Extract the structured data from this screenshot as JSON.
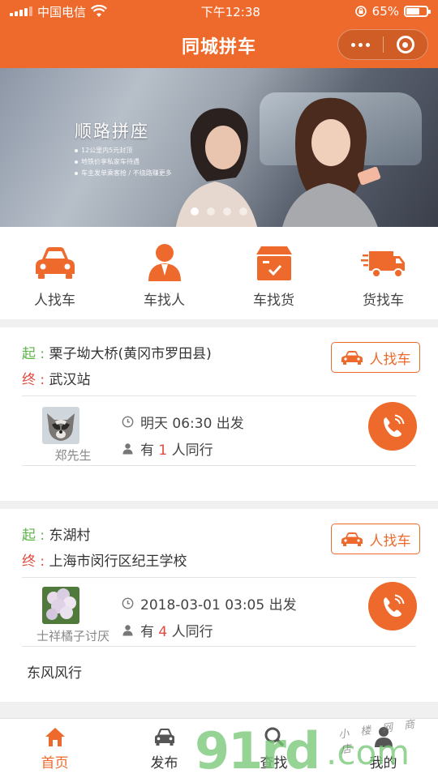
{
  "status_bar": {
    "carrier": "中国电信",
    "time": "下午12:38",
    "battery": "65%"
  },
  "header": {
    "title": "同城拼车"
  },
  "banner": {
    "title": "顺路拼座",
    "lines": [
      "12公里内5元封顶",
      "地铁价享私家车待遇",
      "车主发单乘客抢 / 不绕路赚更多"
    ],
    "slide_count": 4,
    "active_slide": 1
  },
  "categories": [
    {
      "label": "人找车",
      "icon": "car-icon"
    },
    {
      "label": "车找人",
      "icon": "person-icon"
    },
    {
      "label": "车找货",
      "icon": "cargo-box-icon"
    },
    {
      "label": "货找车",
      "icon": "truck-icon"
    }
  ],
  "trips": [
    {
      "start_label": "起",
      "start": "栗子坳大桥(黄冈市罗田县)",
      "end_label": "终",
      "end": "武汉站",
      "tag": "人找车",
      "user": "郑先生",
      "depart": "明天 06:30 出发",
      "companions_prefix": "有",
      "companions": "1",
      "companions_suffix": "人同行",
      "remark": ""
    },
    {
      "start_label": "起",
      "start": "东湖村",
      "end_label": "终",
      "end": "上海市闵行区纪王学校",
      "tag": "人找车",
      "user": "士祥橘子讨厌",
      "depart": "2018-03-01 03:05 出发",
      "companions_prefix": "有",
      "companions": "4",
      "companions_suffix": "人同行",
      "remark": "东风风行"
    }
  ],
  "tabbar": [
    {
      "label": "首页",
      "icon": "home-icon",
      "active": true
    },
    {
      "label": "发布",
      "icon": "car-icon",
      "active": false
    },
    {
      "label": "查找",
      "icon": "search-icon",
      "active": false
    },
    {
      "label": "我的",
      "icon": "user-icon",
      "active": false
    }
  ],
  "watermark": {
    "main": "91rd",
    "suffix": ".com",
    "small": "小 楼 网 商 店"
  },
  "colors": {
    "brand": "#ee6a2c",
    "start": "#5bb547",
    "end": "#e04a3f"
  }
}
